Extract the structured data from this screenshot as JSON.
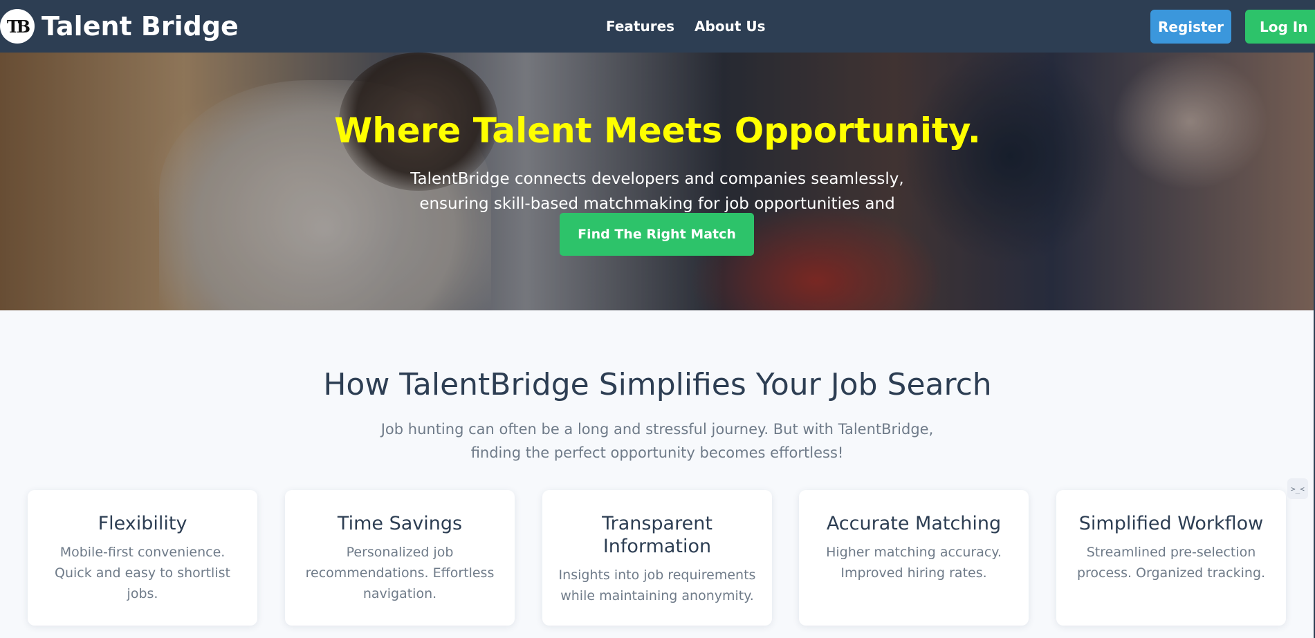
{
  "navbar": {
    "logo_text": "TB",
    "brand_name": "Talent Bridge",
    "links": [
      "Features",
      "About Us"
    ],
    "register_label": "Register",
    "login_label": "Log In"
  },
  "hero": {
    "title": "Where Talent Meets Opportunity.",
    "text": "TalentBridge connects developers and companies seamlessly, ensuring skill-based matchmaking for job opportunities and collaborations.",
    "cta_label": "Find The Right Match"
  },
  "section": {
    "title": "How TalentBridge Simplifies Your Job Search",
    "subtitle": "Job hunting can often be a long and stressful journey. But with TalentBridge, finding the perfect opportunity becomes effortless!"
  },
  "cards": [
    {
      "title": "Flexibility",
      "text": "Mobile-first convenience. Quick and easy to shortlist jobs."
    },
    {
      "title": "Time Savings",
      "text": "Personalized job recommendations. Effortless navigation."
    },
    {
      "title": "Transparent Information",
      "text": "Insights into job requirements while maintaining anonymity."
    },
    {
      "title": "Accurate Matching",
      "text": "Higher matching accuracy. Improved hiring rates."
    },
    {
      "title": "Simplified Workflow",
      "text": "Streamlined pre-selection process. Organized tracking."
    }
  ],
  "side_widget": {
    "icon": "code-icon",
    "text": ">_<"
  },
  "colors": {
    "navbar": "#2d3e53",
    "register": "#3b97dc",
    "login": "#2dc36a",
    "hero_title": "#ffff00"
  }
}
